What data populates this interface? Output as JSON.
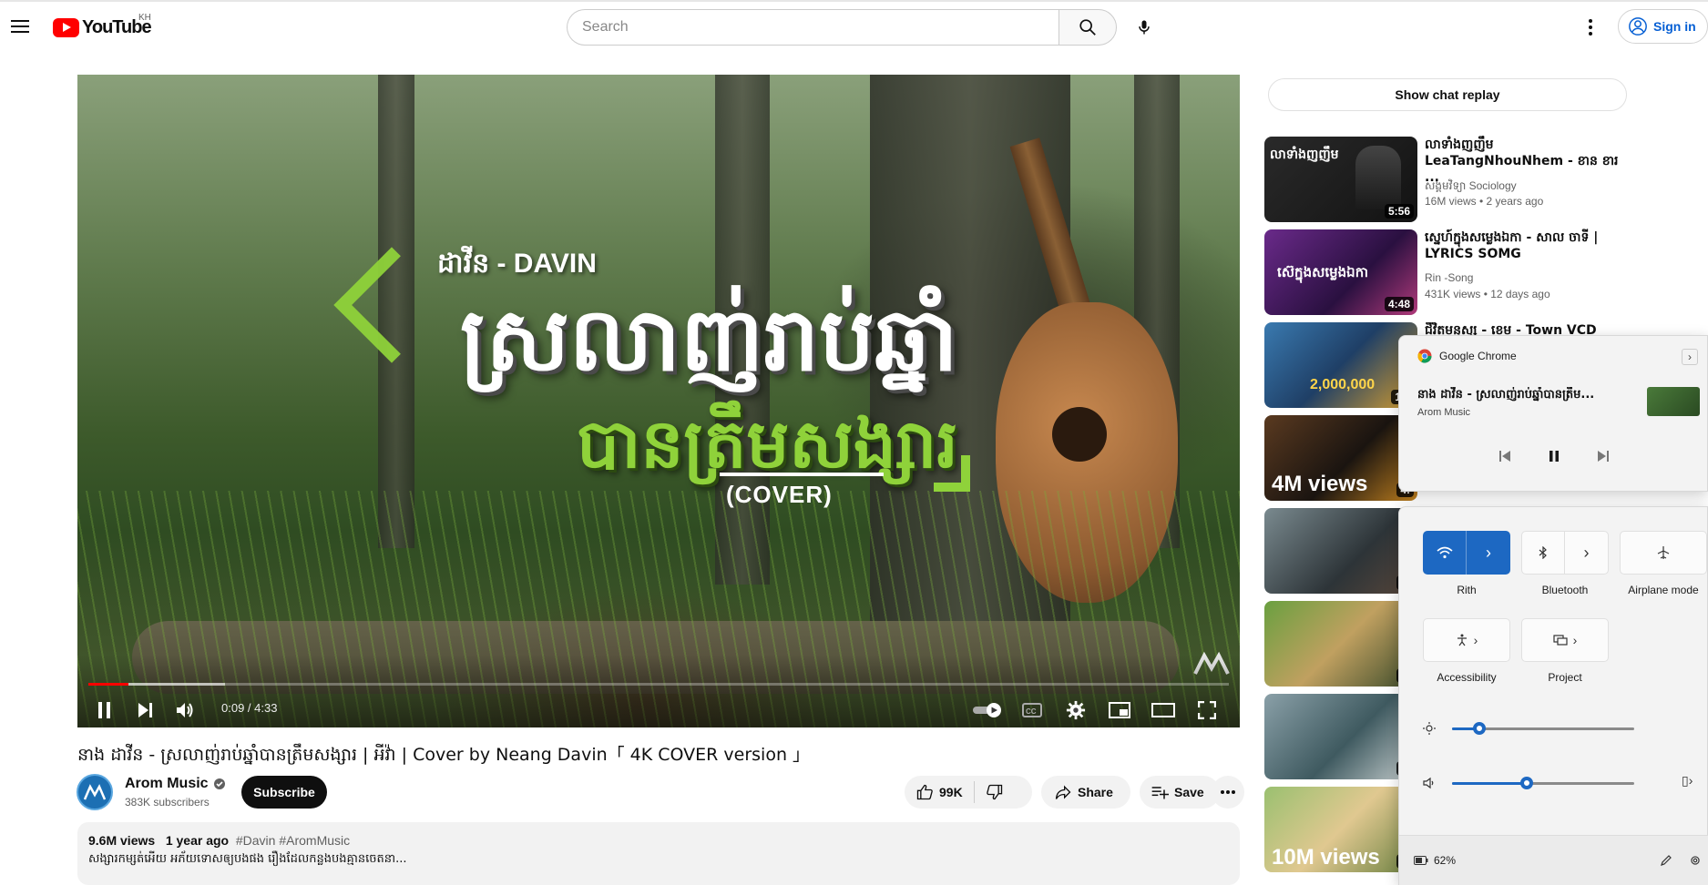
{
  "header": {
    "logo_text": "YouTube",
    "country_code": "KH",
    "search_placeholder": "Search",
    "signin_label": "Sign in"
  },
  "player": {
    "overlay_artist": "ដាវីន - DAVIN",
    "overlay_title": "ស្រលាញ់រាប់ឆ្នាំ",
    "overlay_subtitle": "បានត្រឹមសង្សារ",
    "overlay_cover": "(COVER)",
    "time_display": "0:09 / 4:33",
    "progress_fraction": 0.035
  },
  "video": {
    "title": "នាង ដាវីន - ស្រលាញ់រាប់ឆ្នាំបានត្រឹមសង្សារ | អីវ៉ា | Cover by Neang Davin「 4K COVER version 」",
    "channel_name": "Arom Music",
    "channel_subs": "383K subscribers",
    "subscribe_label": "Subscribe",
    "likes": "99K",
    "share_label": "Share",
    "save_label": "Save",
    "views": "9.6M views",
    "age": "1 year ago",
    "tags": "#Davin #AromMusic",
    "description": "សង្សារកម្សត់អើយ អភ័យទោសឲ្យបងផង រឿងដែលកន្លងបងគ្មានចេតនា..."
  },
  "sidebar": {
    "chat_replay_label": "Show chat replay",
    "recommendations": [
      {
        "title_line1": "លាទាំងញញឹម",
        "title_line2": "LeaTangNhouNhem - ខាន ខារ ...",
        "channel": "សង្គមវិទ្យា Sociology",
        "meta": "16M views  • 2 years ago",
        "duration": "5:56",
        "thumb_text": "លាទាំងញញឹម"
      },
      {
        "title_line1": "ស្នេហ៍ក្នុងសម្លេងឯកា - សាល ចាទី |",
        "title_line2": "LYRICS SOMG",
        "channel": "Rin -Song",
        "meta": "431K views  • 12 days ago",
        "duration": "4:48",
        "thumb_text": "ស៊េក្នុងសម្លេងឯកា"
      },
      {
        "title_line1": "ជីវិតមនុស្ស - ខេម - Town VCD",
        "duration": "11:",
        "thumb_text": "2,000,000"
      },
      {
        "duration": "4:",
        "thumb_text": "4M views"
      },
      {
        "duration": "4:"
      },
      {
        "duration": "3:"
      },
      {
        "duration": "4:"
      },
      {
        "duration": "4:",
        "thumb_text": "10M views"
      }
    ]
  },
  "media_flyout": {
    "app_name": "Google Chrome",
    "track_title": "នាង ដាវីន - ស្រលាញ់រាប់ឆ្នាំបានត្រឹម...",
    "track_artist": "Arom Music"
  },
  "quick_settings": {
    "wifi_label": "Rith",
    "bluetooth_label": "Bluetooth",
    "airplane_label": "Airplane mode",
    "accessibility_label": "Accessibility",
    "project_label": "Project",
    "brightness_fraction": 0.15,
    "volume_fraction": 0.41,
    "battery_label": "62%",
    "accent_color": "#1d68c2"
  }
}
